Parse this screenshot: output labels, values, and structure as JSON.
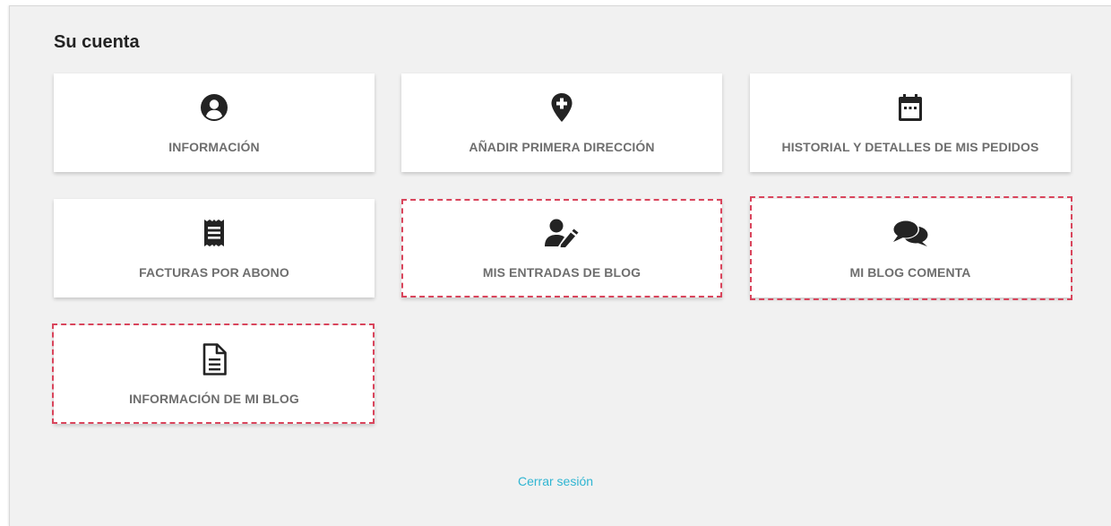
{
  "page": {
    "heading": "Su cuenta",
    "logout_label": "Cerrar sesión"
  },
  "cards": [
    {
      "label": "INFORMACIÓN",
      "icon": "user-circle-icon",
      "highlighted": false
    },
    {
      "label": "AÑADIR PRIMERA DIRECCIÓN",
      "icon": "add-location-pin-icon",
      "highlighted": false
    },
    {
      "label": "HISTORIAL Y DETALLES DE MIS PEDIDOS",
      "icon": "calendar-icon",
      "highlighted": false
    },
    {
      "label": "FACTURAS POR ABONO",
      "icon": "receipt-icon",
      "highlighted": false
    },
    {
      "label": "MIS ENTRADAS DE BLOG",
      "icon": "user-edit-icon",
      "highlighted": true
    },
    {
      "label": "MI BLOG COMENTA",
      "icon": "comments-icon",
      "highlighted": true
    },
    {
      "label": "INFORMACIÓN DE MI BLOG",
      "icon": "document-icon",
      "highlighted": true
    }
  ],
  "colors": {
    "background": "#f1f1f1",
    "card": "#ffffff",
    "label": "#6e6e6e",
    "icon": "#232323",
    "highlight_border": "#d9455c",
    "link": "#2fb5d2"
  }
}
